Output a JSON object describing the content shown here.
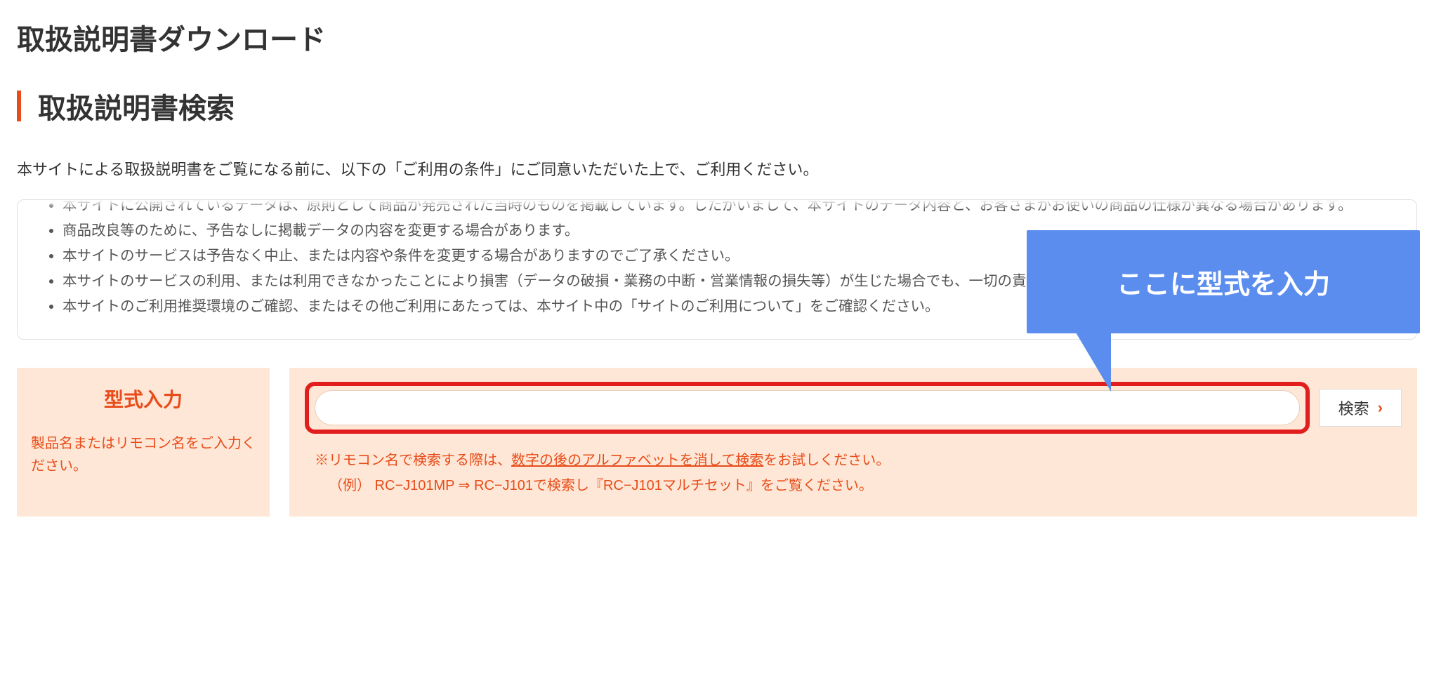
{
  "page": {
    "title": "取扱説明書ダウンロード"
  },
  "section": {
    "title": "取扱説明書検索",
    "intro": "本サイトによる取扱説明書をご覧になる前に、以下の「ご利用の条件」にご同意いただいた上で、ご利用ください。"
  },
  "conditions": {
    "items": [
      "本サイトに公開されているデータは、原則として商品が発売された当時のものを掲載しています。したがいまして、本サイトのデータ内容と、お客さまがお使いの商品の仕様が異なる場合があります。",
      "商品改良等のために、予告なしに掲載データの内容を変更する場合があります。",
      "本サイトのサービスは予告なく中止、または内容や条件を変更する場合がありますのでご了承ください。",
      "本サイトのサービスの利用、または利用できなかったことにより損害（データの破損・業務の中断・営業情報の損失等）が生じた場合でも、一切の責任を負いませんことをご了承ください。",
      "本サイトのご利用推奨環境のご確認、またはその他ご利用にあたっては、本サイト中の「サイトのご利用について」をご確認ください。"
    ]
  },
  "search": {
    "label_title": "型式入力",
    "label_sub": "製品名またはリモコン名をご入力ください。",
    "input_value": "",
    "button_label": "検索",
    "hint_prefix": "※リモコン名で検索する際は、",
    "hint_underline": "数字の後のアルファベットを消して検索",
    "hint_suffix": "をお試しください。",
    "hint_example": "（例） RC−J101MP ⇒ RC−J101で検索し『RC−J101マルチセット』をご覧ください。"
  },
  "callout": {
    "text": "ここに型式を入力"
  }
}
